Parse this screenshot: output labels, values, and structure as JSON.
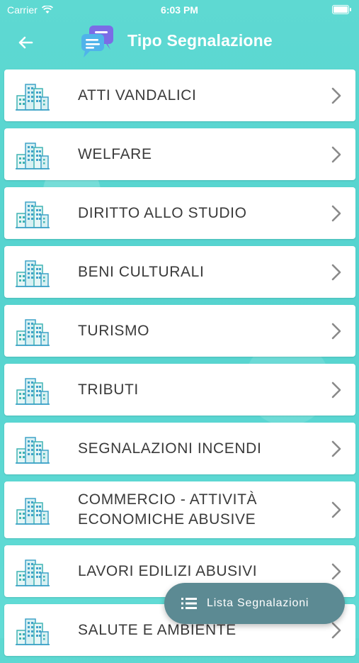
{
  "status_bar": {
    "carrier": "Carrier",
    "time": "6:03 PM"
  },
  "header": {
    "title": "Tipo Segnalazione",
    "back_icon": "arrow-left-icon",
    "logo_icon": "chat-bubbles-icon"
  },
  "categories": [
    {
      "label": "ATTI VANDALICI"
    },
    {
      "label": "WELFARE"
    },
    {
      "label": "DIRITTO ALLO STUDIO"
    },
    {
      "label": "BENI CULTURALI"
    },
    {
      "label": "TURISMO"
    },
    {
      "label": "TRIBUTI"
    },
    {
      "label": "SEGNALAZIONI INCENDI"
    },
    {
      "label_line1": "COMMERCIO - ATTIVITÀ",
      "label_line2": "ECONOMICHE ABUSIVE"
    },
    {
      "label": "LAVORI EDILIZI ABUSIVI"
    },
    {
      "label": "SALUTE E AMBIENTE"
    }
  ],
  "fab": {
    "label": "Lista Segnalazioni",
    "icon": "list-icon"
  },
  "colors": {
    "background": "#5ed9d2",
    "card": "#ffffff",
    "fab": "#5c8a93",
    "text": "#3a3a3a"
  }
}
